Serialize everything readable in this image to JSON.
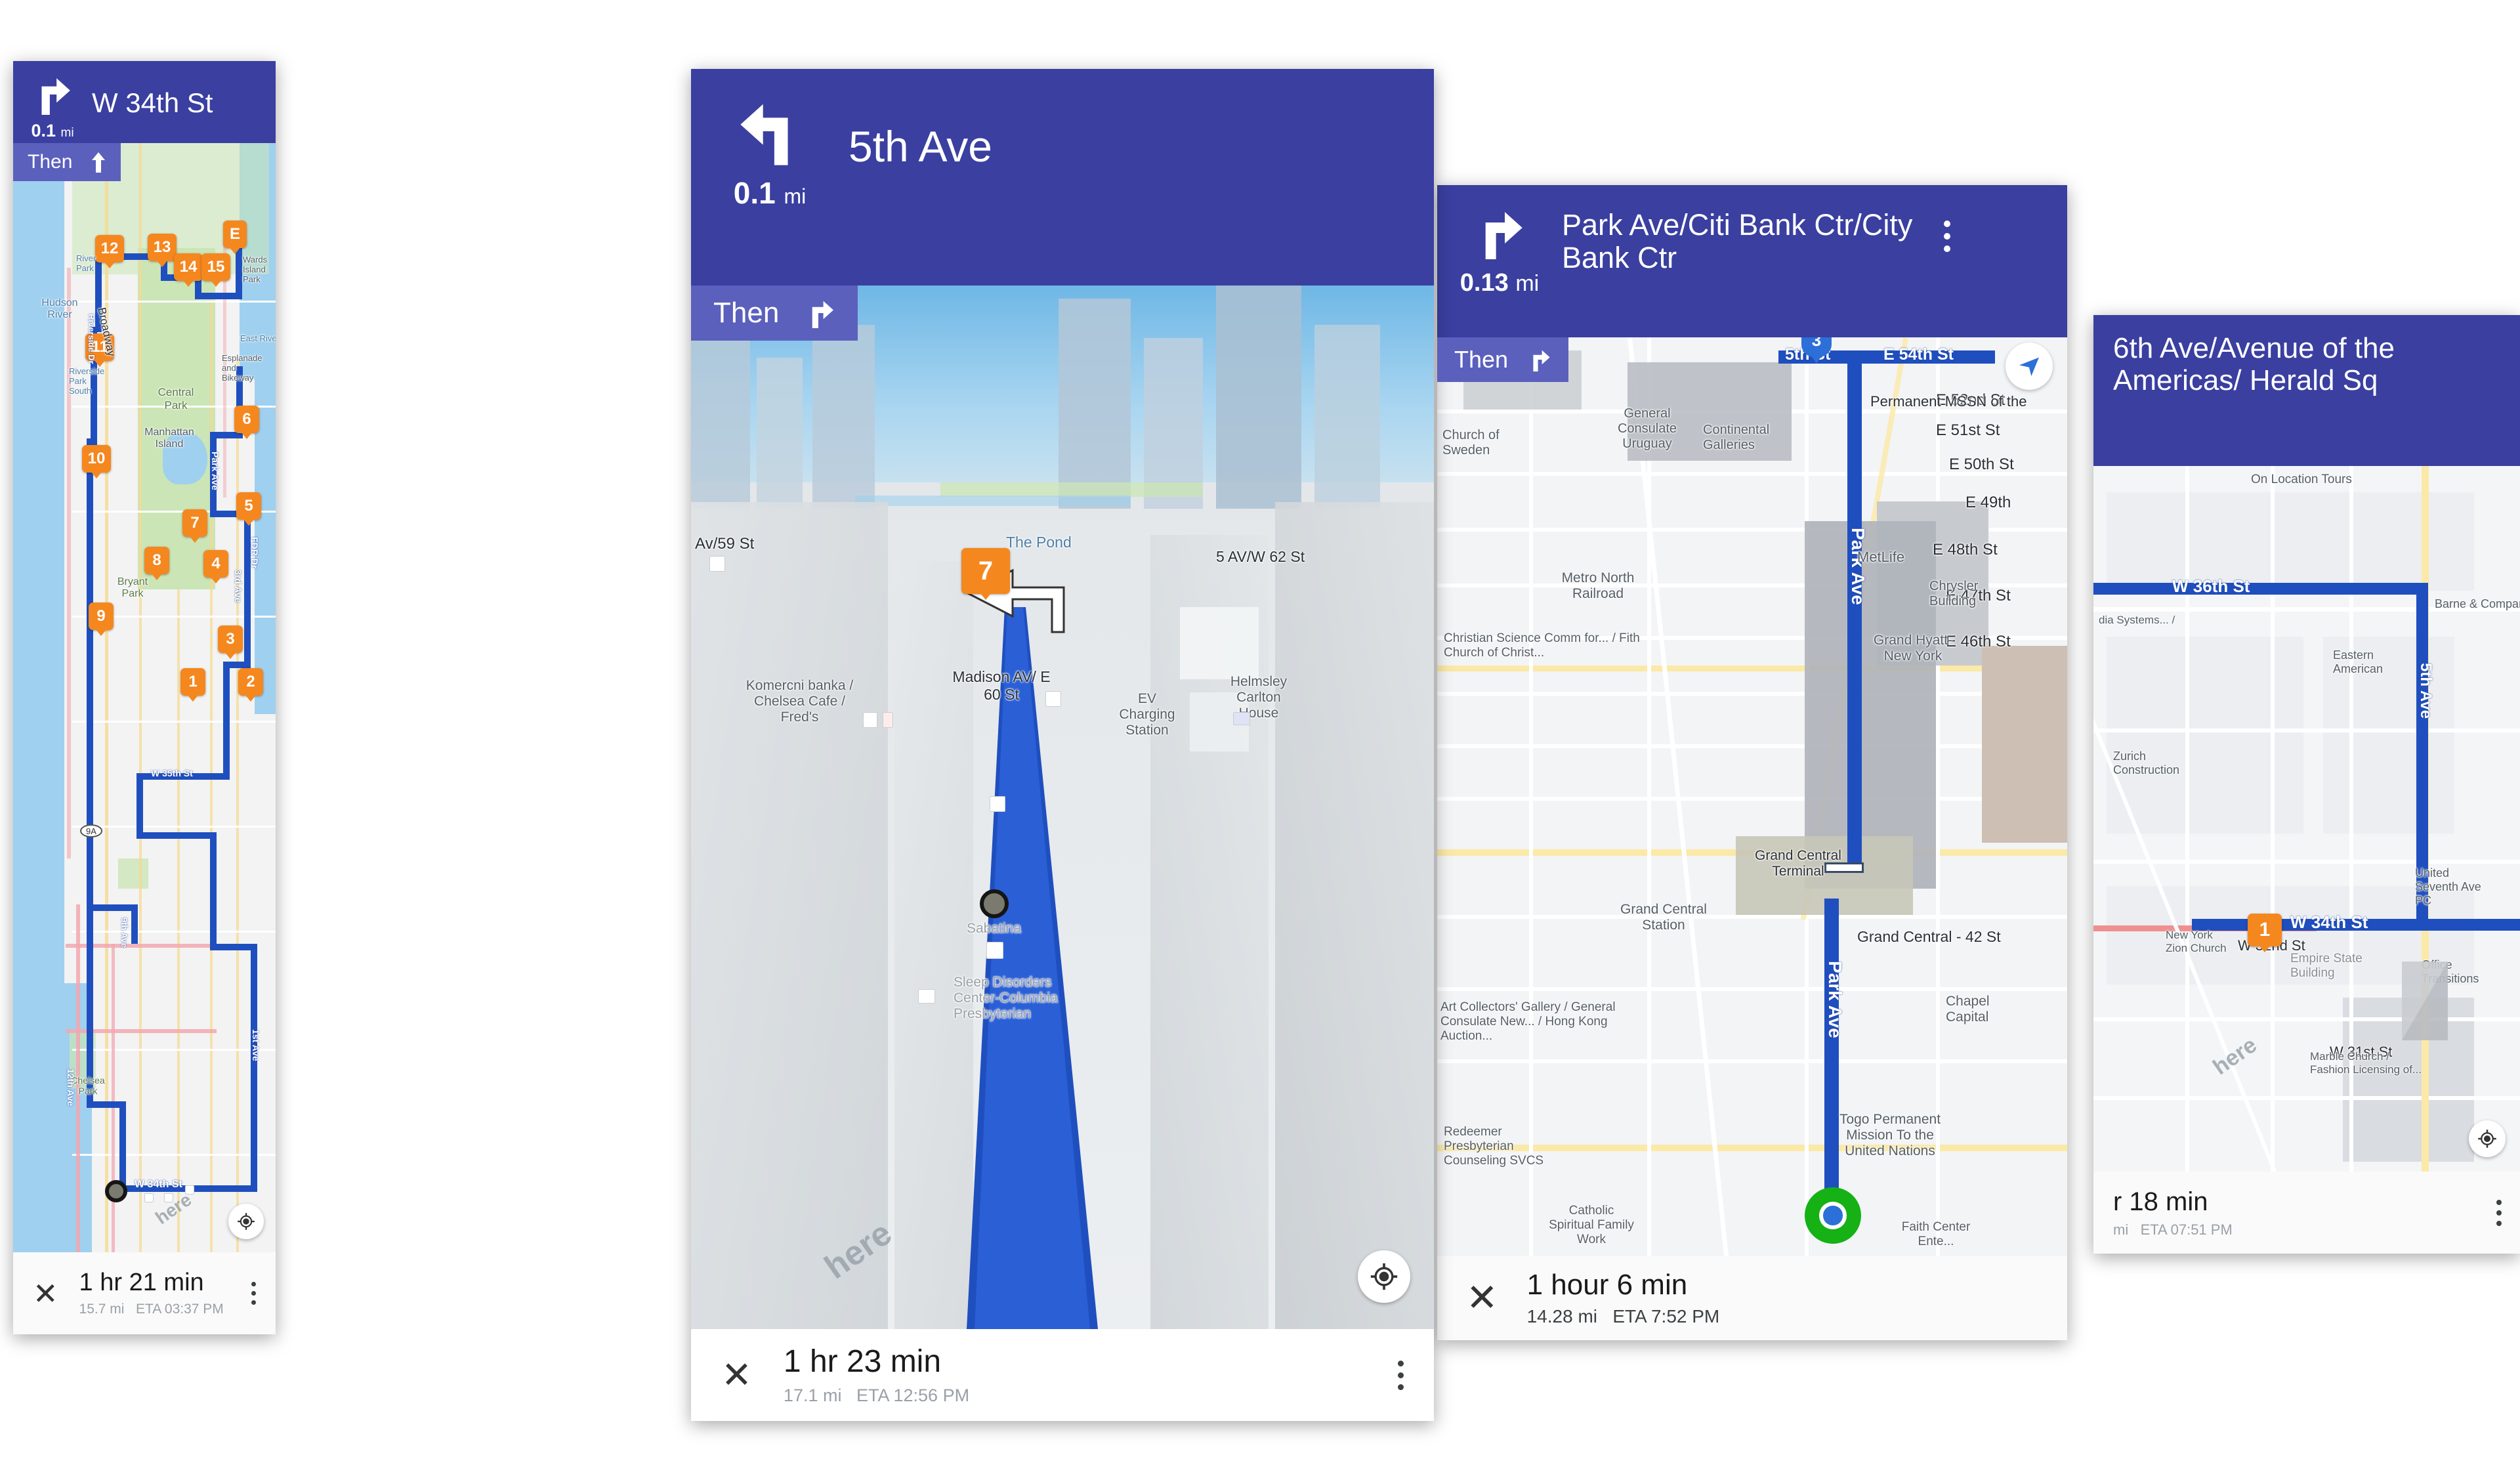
{
  "panels": [
    {
      "id": "panel-1",
      "header": {
        "turn_icon": "turn-right-icon",
        "distance_value": "0.1",
        "distance_unit": "mi",
        "street": "W 34th St",
        "then_label": "Then",
        "then_icon": "continue-straight-icon"
      },
      "bottom": {
        "close_icon": "close-icon",
        "duration": "1 hr 21 min",
        "distance": "15.7 mi",
        "eta": "ETA 03:37 PM",
        "menu_icon": "overflow-menu-icon"
      },
      "map": {
        "waypoints": [
          "1",
          "2",
          "3",
          "4",
          "5",
          "6",
          "7",
          "8",
          "9",
          "10",
          "11",
          "12",
          "13",
          "14",
          "15",
          "E"
        ],
        "labels": [
          "Hudson River",
          "Central Park",
          "Manhattan Island",
          "Bryant Park",
          "Chelsea Park",
          "Broadway",
          "Riverside Park South",
          "Riverside Dr",
          "Esplanade and Bikeway",
          "East River",
          "FDR Dr",
          "Park Ave",
          "3rd Ave",
          "1st Ave",
          "12th Ave",
          "9th Ave",
          "W 34th St",
          "W 35th St",
          "Wards Island Park",
          "River Park",
          "9A"
        ],
        "gps_icon": "my-location-icon",
        "watermark": "here"
      }
    },
    {
      "id": "panel-2",
      "header": {
        "turn_icon": "turn-left-icon",
        "distance_value": "0.1",
        "distance_unit": "mi",
        "street": "5th Ave",
        "then_label": "Then",
        "then_icon": "turn-right-icon"
      },
      "bottom": {
        "close_icon": "close-icon",
        "duration": "1 hr 23 min",
        "distance": "17.1 mi",
        "eta": "ETA 12:56 PM",
        "menu_icon": "overflow-menu-icon"
      },
      "map": {
        "waypoints": [
          "7"
        ],
        "labels": [
          "Av/59 St",
          "The Pond",
          "5 AV/W 62 St",
          "Madison AV/ E 60 St",
          "Komercni banka / Chelsea Cafe / Fred's",
          "EV Charging Station",
          "Helmsley Carlton House",
          "Sabatina",
          "Sleep Disorders Center-Columbia Presbyterian"
        ],
        "gps_icon": "my-location-icon",
        "watermark": "here"
      }
    },
    {
      "id": "panel-3",
      "header": {
        "turn_icon": "turn-right-icon",
        "distance_value": "0.13",
        "distance_unit": "mi",
        "street": "Park Ave/Citi Bank Ctr/City Bank Ctr",
        "then_label": "Then",
        "then_icon": "turn-right-icon",
        "menu_icon": "overflow-menu-icon"
      },
      "bottom": {
        "close_icon": "close-icon",
        "duration": "1 hour 6 min",
        "distance": "14.28 mi",
        "eta": "ETA 7:52 PM"
      },
      "map": {
        "pin_number": "3",
        "labels": [
          "E 54th St",
          "E 52nd St",
          "E 51st St",
          "E 50th St",
          "E 49th",
          "E 48th St",
          "E 47th St",
          "E 46th St",
          "5th St",
          "Park Ave",
          "General Consulate Uruguay",
          "Church of Sweden",
          "Continental Galleries",
          "Metro North Railroad",
          "Christian Science Comm for... / Fith Church of Christ...",
          "Grand Central Terminal",
          "Grand Central Station",
          "Grand Central - 42 St",
          "Grand Hyatt-New York",
          "Chrysler Building",
          "MetLife",
          "Chapel Capital",
          "Art Collectors' Gallery / General Consulate New... / Hong Kong Auction...",
          "Togo Permanent Mission To the United Nations",
          "Redeemer Presbyterian Counseling SVCS",
          "Catholic Spiritual Family Work",
          "Faith Center Ente...",
          "Permanent MSSN of the",
          "51 St"
        ],
        "navigation_arrow_icon": "navigation-arrow-icon"
      }
    },
    {
      "id": "panel-4",
      "header": {
        "street": "6th Ave/Avenue of the Americas/ Herald Sq"
      },
      "bottom": {
        "duration": "r 18 min",
        "distance": "mi",
        "eta": "ETA 07:51 PM",
        "menu_icon": "overflow-menu-icon"
      },
      "map": {
        "waypoints": [
          "1"
        ],
        "labels": [
          "On Location Tours",
          "W 36th St",
          "W 34th St",
          "W 32nd St",
          "W 31st St",
          "5th Ave",
          "5th",
          "Barne & Company",
          "Eastern American",
          "Zurich Construction",
          "Empire State Building",
          "Church of Jesu",
          "New York Zion Church",
          "United Seventh Ave PC",
          "Office Transitions",
          "Marble Church / Fashion Licensing of...",
          "dia Systems... /",
          "On Location Tours"
        ],
        "gps_icon": "my-location-icon",
        "watermark": "here"
      }
    }
  ],
  "colors": {
    "header_blue": "#3a3fa0",
    "then_blue": "#5b60bd",
    "waypoint_orange": "#f5871f",
    "route_blue": "#1f4fbf",
    "bottom_bg": "#fafafa",
    "destination_green": "#15b115"
  }
}
